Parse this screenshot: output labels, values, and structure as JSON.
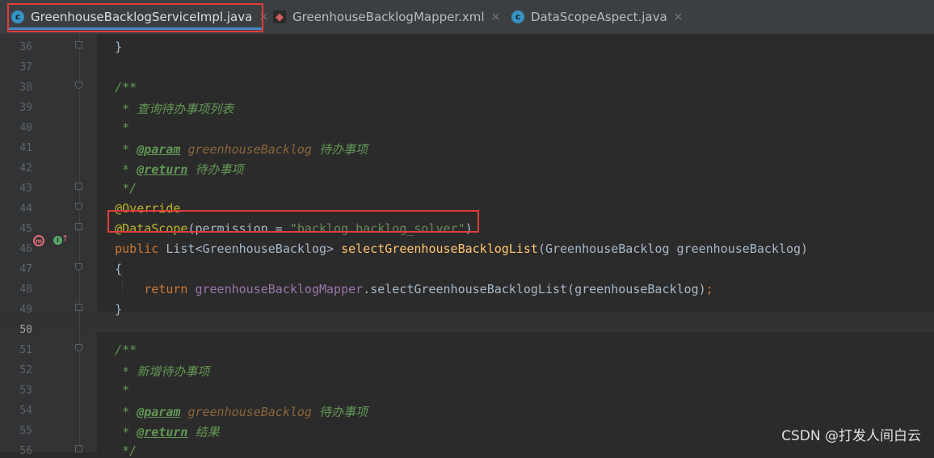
{
  "tabs": [
    {
      "label": "GreenhouseBacklogServiceImpl.java",
      "icon": "java-class-icon",
      "active": true
    },
    {
      "label": "GreenhouseBacklogMapper.xml",
      "icon": "xml-mapper-icon",
      "active": false
    },
    {
      "label": "DataScopeAspect.java",
      "icon": "java-class-icon",
      "active": false
    }
  ],
  "tab_icon_letter": "c",
  "close_glyph": "×",
  "lines": [
    {
      "n": "36",
      "tokens": [
        [
          "plain",
          "    }"
        ]
      ]
    },
    {
      "n": "37",
      "tokens": []
    },
    {
      "n": "38",
      "tokens": [
        [
          "com",
          "    /**"
        ]
      ]
    },
    {
      "n": "39",
      "tokens": [
        [
          "com",
          "     * 查询待办事项列表"
        ]
      ]
    },
    {
      "n": "40",
      "tokens": [
        [
          "com",
          "     *"
        ]
      ]
    },
    {
      "n": "41",
      "tokens": [
        [
          "com",
          "     * "
        ],
        [
          "tag",
          "@param"
        ],
        [
          "com",
          " "
        ],
        [
          "param",
          "greenhouseBacklog"
        ],
        [
          "com",
          " 待办事项"
        ]
      ]
    },
    {
      "n": "42",
      "tokens": [
        [
          "com",
          "     * "
        ],
        [
          "tag",
          "@return"
        ],
        [
          "com",
          " 待办事项"
        ]
      ]
    },
    {
      "n": "43",
      "tokens": [
        [
          "com",
          "     */"
        ]
      ]
    },
    {
      "n": "44",
      "tokens": [
        [
          "ann",
          "    @Override"
        ]
      ]
    },
    {
      "n": "45",
      "tokens": [
        [
          "ann",
          "    @DataScope"
        ],
        [
          "plain",
          "(permission = "
        ],
        [
          "str",
          "\"backlog.backlog_solver\""
        ],
        [
          "plain",
          ")"
        ]
      ]
    },
    {
      "n": "46",
      "tokens": [
        [
          "kw",
          "    public "
        ],
        [
          "plain",
          "List<GreenhouseBacklog> "
        ],
        [
          "fn",
          "selectGreenhouseBacklogList"
        ],
        [
          "plain",
          "(GreenhouseBacklog greenhouseBacklog)"
        ]
      ]
    },
    {
      "n": "47",
      "tokens": [
        [
          "plain",
          "    {"
        ]
      ]
    },
    {
      "n": "48",
      "tokens": [
        [
          "kw",
          "        return "
        ],
        [
          "field",
          "greenhouseBacklogMapper"
        ],
        [
          "plain",
          ".selectGreenhouseBacklogList(greenhouseBacklog)"
        ],
        [
          "kw",
          ";"
        ]
      ]
    },
    {
      "n": "49",
      "tokens": [
        [
          "plain",
          "    }"
        ]
      ]
    },
    {
      "n": "50",
      "tokens": []
    },
    {
      "n": "51",
      "tokens": [
        [
          "com",
          "    /**"
        ]
      ]
    },
    {
      "n": "52",
      "tokens": [
        [
          "com",
          "     * 新增待办事项"
        ]
      ]
    },
    {
      "n": "53",
      "tokens": [
        [
          "com",
          "     *"
        ]
      ]
    },
    {
      "n": "54",
      "tokens": [
        [
          "com",
          "     * "
        ],
        [
          "tag",
          "@param"
        ],
        [
          "com",
          " "
        ],
        [
          "param",
          "greenhouseBacklog"
        ],
        [
          "com",
          " 待办事项"
        ]
      ]
    },
    {
      "n": "55",
      "tokens": [
        [
          "com",
          "     * "
        ],
        [
          "tag",
          "@return"
        ],
        [
          "com",
          " 结果"
        ]
      ]
    },
    {
      "n": "56",
      "tokens": [
        [
          "com",
          "     */"
        ]
      ]
    }
  ],
  "current_line": "50",
  "gutter_icons": {
    "method_marker": "m",
    "implements_marker": "I",
    "arrow": "↑"
  },
  "watermark": "CSDN @打发人间白云",
  "colors": {
    "background": "#2b2b2b",
    "keyword": "#cc7832",
    "annotation": "#bbb529",
    "string": "#6a8759",
    "comment": "#629755",
    "highlight_box": "#e23b3b"
  }
}
